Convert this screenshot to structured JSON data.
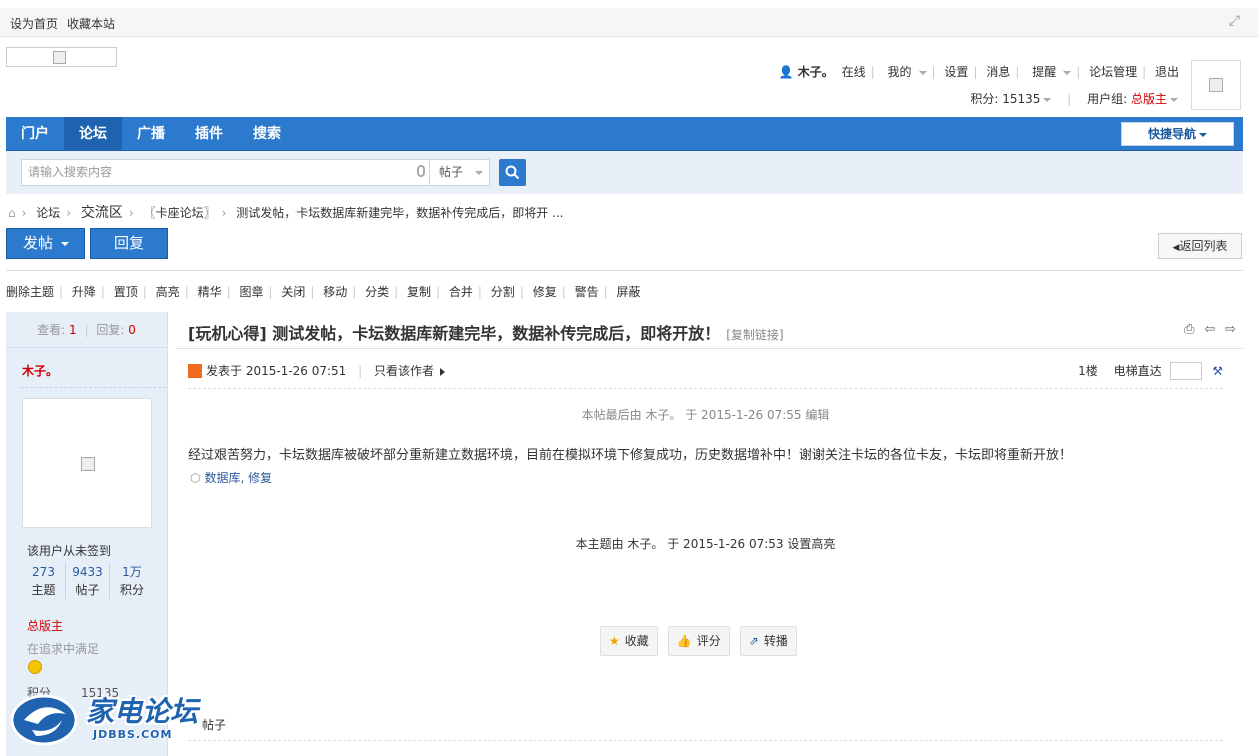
{
  "topbar": {
    "set_home": "设为首页",
    "bookmark": "收藏本站"
  },
  "user": {
    "name": "木子。",
    "online": "在线",
    "mine": "我的",
    "settings": "设置",
    "messages": "消息",
    "remind": "提醒",
    "admin": "论坛管理",
    "logout": "退出",
    "points_label": "积分: 15135",
    "group_label": "用户组:",
    "group_value": "总版主"
  },
  "nav": {
    "items": [
      "门户",
      "论坛",
      "广播",
      "插件",
      "搜索"
    ],
    "active_index": 1,
    "quick_nav": "快捷导航"
  },
  "search": {
    "placeholder": "请输入搜索内容",
    "type": "帖子"
  },
  "breadcrumb": {
    "forum": "论坛",
    "section": "交流区",
    "board": "〖卡座论坛〗",
    "thread": "测试发帖，卡坛数据库新建完毕，数据补传完成后，即将开 ..."
  },
  "buttons": {
    "post": "发帖",
    "reply": "回复",
    "back": "返回列表"
  },
  "mod_tools": [
    "删除主题",
    "升降",
    "置顶",
    "高亮",
    "精华",
    "图章",
    "关闭",
    "移动",
    "分类",
    "复制",
    "合并",
    "分割",
    "修复",
    "警告",
    "屏蔽"
  ],
  "thread": {
    "views_label": "查看:",
    "views": "1",
    "replies_label": "回复:",
    "replies": "0",
    "title": "[玩机心得] 测试发帖，卡坛数据库新建完毕，数据补传完成后，即将开放！",
    "copy_link": "[复制链接]"
  },
  "author": {
    "name": "木子。",
    "sign_status": "该用户从未签到",
    "stats": [
      {
        "value": "273",
        "label": "主题"
      },
      {
        "value": "9433",
        "label": "帖子"
      },
      {
        "value": "1万",
        "label": "积分"
      }
    ],
    "rank": "总版主",
    "motto": "在追求中满足",
    "score_label": "积分",
    "score_value": "15135"
  },
  "post": {
    "posted_at": "发表于 2015-1-26 07:51",
    "only_author": "只看该作者",
    "floor": "1楼",
    "jump_label": "电梯直达",
    "edited_note": "本帖最后由 木子。 于 2015-1-26 07:55 编辑",
    "content": "经过艰苦努力，卡坛数据库被破坏部分重新建立数据环境，目前在模拟环境下修复成功，历史数据增补中！谢谢关注卡坛的各位卡友，卡坛即将重新开放！",
    "tags": "数据库, 修复",
    "highlight_note": "本主题由 木子。 于 2015-1-26 07:53 设置高亮",
    "actions": {
      "favorite": "收藏",
      "rate": "评分",
      "share": "转播"
    }
  },
  "bottom": {
    "more_posts": "帖子",
    "partial": "积分"
  },
  "watermark": {
    "name": "家电论坛",
    "domain": "JDBBS.COM"
  },
  "colors": {
    "primary": "#2b7acd",
    "accent_red": "#cc0000",
    "sidebar_bg": "#e6eef7"
  }
}
